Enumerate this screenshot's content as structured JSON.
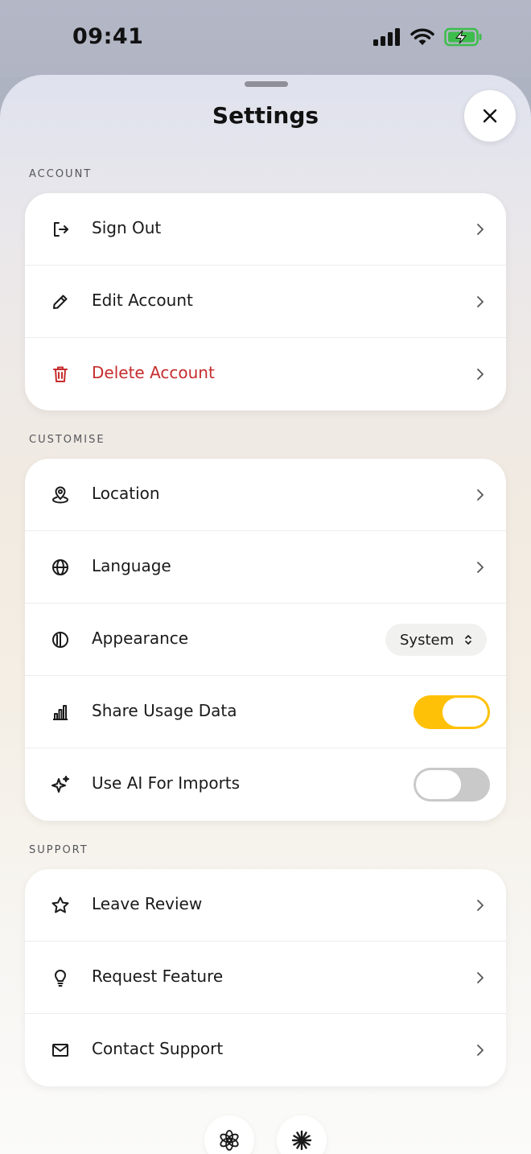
{
  "status_bar": {
    "time": "09:41"
  },
  "header": {
    "title": "Settings"
  },
  "sections": [
    {
      "label": "ACCOUNT",
      "items": [
        {
          "label": "Sign Out",
          "icon": "sign-out-icon"
        },
        {
          "label": "Edit Account",
          "icon": "pencil-icon"
        },
        {
          "label": "Delete Account",
          "icon": "trash-icon",
          "color": "#c62d2d"
        }
      ]
    },
    {
      "label": "CUSTOMISE",
      "items": [
        {
          "label": "Location",
          "icon": "location-pin-icon"
        },
        {
          "label": "Language",
          "icon": "globe-icon"
        },
        {
          "label": "Appearance",
          "icon": "contrast-icon",
          "value": "System"
        },
        {
          "label": "Share Usage Data",
          "icon": "bar-chart-icon",
          "toggle": true
        },
        {
          "label": "Use AI For Imports",
          "icon": "sparkles-icon",
          "toggle": false
        }
      ]
    },
    {
      "label": "SUPPORT",
      "items": [
        {
          "label": "Leave Review",
          "icon": "star-icon"
        },
        {
          "label": "Request Feature",
          "icon": "lightbulb-icon"
        },
        {
          "label": "Contact Support",
          "icon": "mail-icon"
        }
      ]
    }
  ],
  "footer_icons": [
    "openai-logo-icon",
    "asterisk-logo-icon"
  ],
  "colors": {
    "accent": "#ffc107",
    "danger": "#c62d2d"
  }
}
